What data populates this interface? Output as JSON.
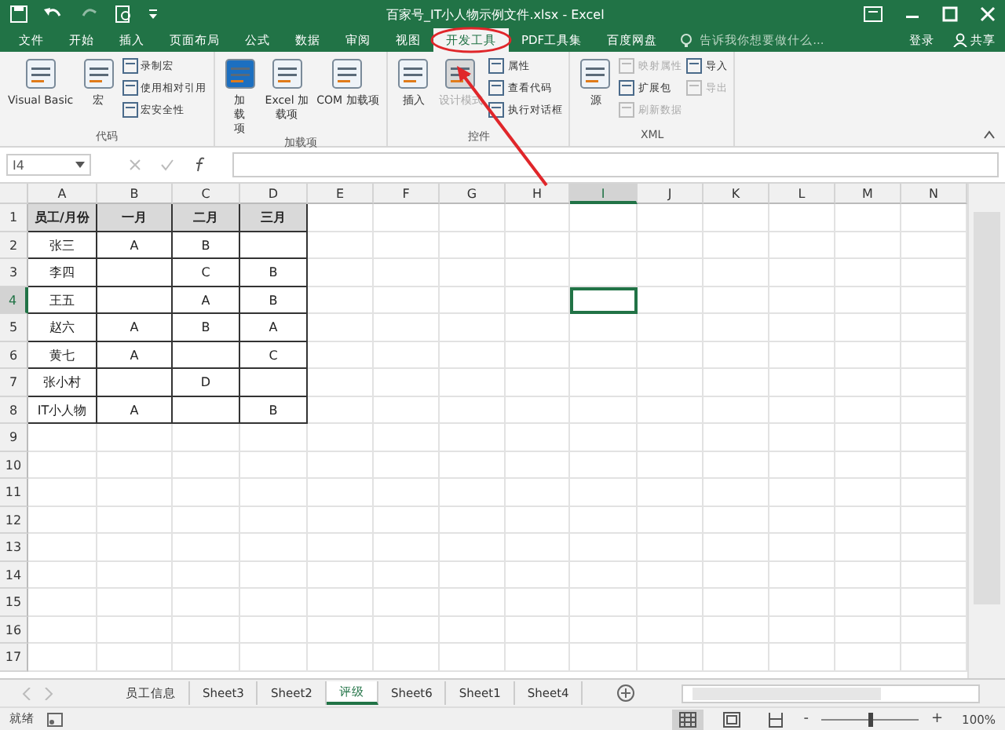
{
  "window": {
    "title": "百家号_IT小人物示例文件.xlsx - Excel"
  },
  "menu_tabs": [
    {
      "label": "文件",
      "selected": false
    },
    {
      "label": "开始",
      "selected": false
    },
    {
      "label": "插入",
      "selected": false
    },
    {
      "label": "页面布局",
      "selected": false
    },
    {
      "label": "公式",
      "selected": false
    },
    {
      "label": "数据",
      "selected": false
    },
    {
      "label": "审阅",
      "selected": false
    },
    {
      "label": "视图",
      "selected": false
    },
    {
      "label": "开发工具",
      "selected": true
    },
    {
      "label": "PDF工具集",
      "selected": false
    },
    {
      "label": "百度网盘",
      "selected": false
    }
  ],
  "search": {
    "placeholder": "告诉我你想要做什么..."
  },
  "account": {
    "sign_in": "登录",
    "share": "共享"
  },
  "ribbon_groups": [
    {
      "label": "代码",
      "items": [
        {
          "kind": "large",
          "label": "Visual Basic",
          "disabled": false
        },
        {
          "kind": "large",
          "label": "宏",
          "disabled": false
        },
        {
          "kind": "small",
          "label": "录制宏",
          "disabled": false
        },
        {
          "kind": "small",
          "label": "使用相对引用",
          "disabled": false
        },
        {
          "kind": "small",
          "label": "宏安全性",
          "disabled": false
        }
      ]
    },
    {
      "label": "加载项",
      "items": [
        {
          "kind": "large",
          "label": "加载项",
          "disabled": false
        },
        {
          "kind": "large",
          "label": "Excel 加载项",
          "disabled": false
        },
        {
          "kind": "large",
          "label": "COM 加载项",
          "disabled": false
        }
      ]
    },
    {
      "label": "控件",
      "items": [
        {
          "kind": "large",
          "label": "插入",
          "disabled": false
        },
        {
          "kind": "large",
          "label": "设计模式",
          "disabled": true
        },
        {
          "kind": "small",
          "label": "属性",
          "disabled": false
        },
        {
          "kind": "small",
          "label": "查看代码",
          "disabled": false
        },
        {
          "kind": "small",
          "label": "执行对话框",
          "disabled": false
        }
      ]
    },
    {
      "label": "XML",
      "items": [
        {
          "kind": "large",
          "label": "源",
          "disabled": false
        },
        {
          "kind": "small",
          "label": "映射属性",
          "disabled": true
        },
        {
          "kind": "small",
          "label": "扩展包",
          "disabled": false
        },
        {
          "kind": "small",
          "label": "刷新数据",
          "disabled": true
        },
        {
          "kind": "small",
          "label": "导入",
          "disabled": false
        },
        {
          "kind": "small",
          "label": "导出",
          "disabled": true
        }
      ]
    }
  ],
  "name_box": {
    "value": "I4"
  },
  "columns": [
    {
      "label": "A",
      "selected": false
    },
    {
      "label": "B",
      "selected": false
    },
    {
      "label": "C",
      "selected": false
    },
    {
      "label": "D",
      "selected": false
    },
    {
      "label": "E",
      "selected": false
    },
    {
      "label": "F",
      "selected": false
    },
    {
      "label": "G",
      "selected": false
    },
    {
      "label": "H",
      "selected": false
    },
    {
      "label": "I",
      "selected": true
    },
    {
      "label": "J",
      "selected": false
    },
    {
      "label": "K",
      "selected": false
    },
    {
      "label": "L",
      "selected": false
    },
    {
      "label": "M",
      "selected": false
    },
    {
      "label": "N",
      "selected": false
    }
  ],
  "rows": [
    {
      "number": "1",
      "selected": false,
      "kind": "header",
      "cells": [
        "员工/月份",
        "一月",
        "二月",
        "三月"
      ]
    },
    {
      "number": "2",
      "selected": false,
      "kind": "data",
      "cells": [
        "张三",
        "A",
        "B",
        null
      ]
    },
    {
      "number": "3",
      "selected": false,
      "kind": "data",
      "cells": [
        "李四",
        null,
        "C",
        "B"
      ]
    },
    {
      "number": "4",
      "selected": true,
      "kind": "data",
      "cells": [
        "王五",
        null,
        "A",
        "B"
      ]
    },
    {
      "number": "5",
      "selected": false,
      "kind": "data",
      "cells": [
        "赵六",
        "A",
        "B",
        "A"
      ]
    },
    {
      "number": "6",
      "selected": false,
      "kind": "data",
      "cells": [
        "黄七",
        "A",
        null,
        "C"
      ]
    },
    {
      "number": "7",
      "selected": false,
      "kind": "data",
      "cells": [
        "张小村",
        null,
        "D",
        null
      ]
    },
    {
      "number": "8",
      "selected": false,
      "kind": "data",
      "cells": [
        "IT小人物",
        "A",
        null,
        "B"
      ]
    },
    {
      "number": "9",
      "selected": false
    },
    {
      "number": "10",
      "selected": false
    },
    {
      "number": "11",
      "selected": false
    },
    {
      "number": "12",
      "selected": false
    },
    {
      "number": "13",
      "selected": false
    },
    {
      "number": "14",
      "selected": false
    },
    {
      "number": "15",
      "selected": false
    },
    {
      "number": "16",
      "selected": false
    },
    {
      "number": "17",
      "selected": false
    }
  ],
  "sheets": [
    {
      "label": "员工信息",
      "selected": false
    },
    {
      "label": "Sheet3",
      "selected": false
    },
    {
      "label": "Sheet2",
      "selected": false
    },
    {
      "label": "评级",
      "selected": true
    },
    {
      "label": "Sheet6",
      "selected": false
    },
    {
      "label": "Sheet1",
      "selected": false
    },
    {
      "label": "Sheet4",
      "selected": false
    }
  ],
  "status_bar": {
    "status": "就绪",
    "zoom": {
      "out_label": "-",
      "level": 0.5,
      "in_label": "+",
      "reading": "100%"
    }
  }
}
